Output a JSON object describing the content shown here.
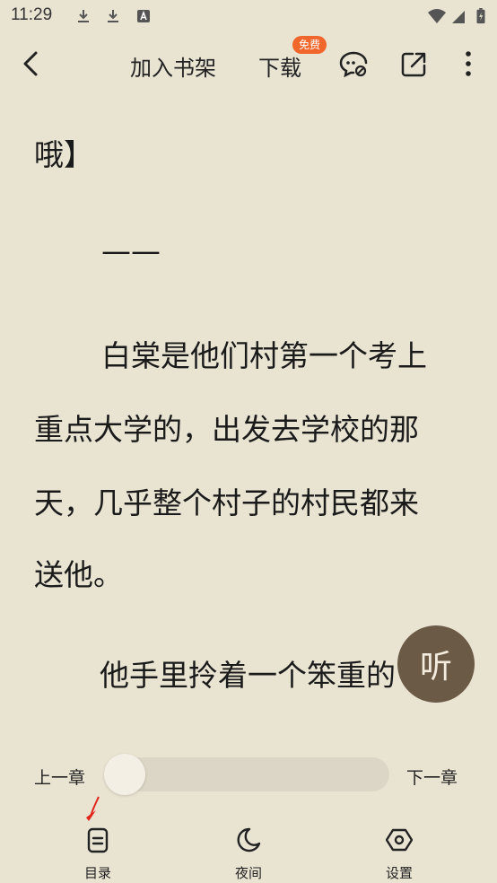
{
  "status_bar": {
    "time": "11:29"
  },
  "toolbar": {
    "add_shelf": "加入书架",
    "download": "下载",
    "download_badge": "免费"
  },
  "content": {
    "lines": [
      "哦】",
      "——",
      "白棠是他们村第一个考上",
      "重点大学的，出发去学校的那",
      "天，几乎整个村子的村民都来",
      "送他。",
      "他手里拎着一个笨重的"
    ]
  },
  "listen_button": {
    "label": "听"
  },
  "chapter_nav": {
    "prev": "上一章",
    "next": "下一章",
    "progress": 0
  },
  "bottom_nav": {
    "toc": "目录",
    "night": "夜间",
    "settings": "设置"
  },
  "colors": {
    "background": "#e9e3d2",
    "badge": "#f0662b",
    "listen": "#6b5a45"
  }
}
